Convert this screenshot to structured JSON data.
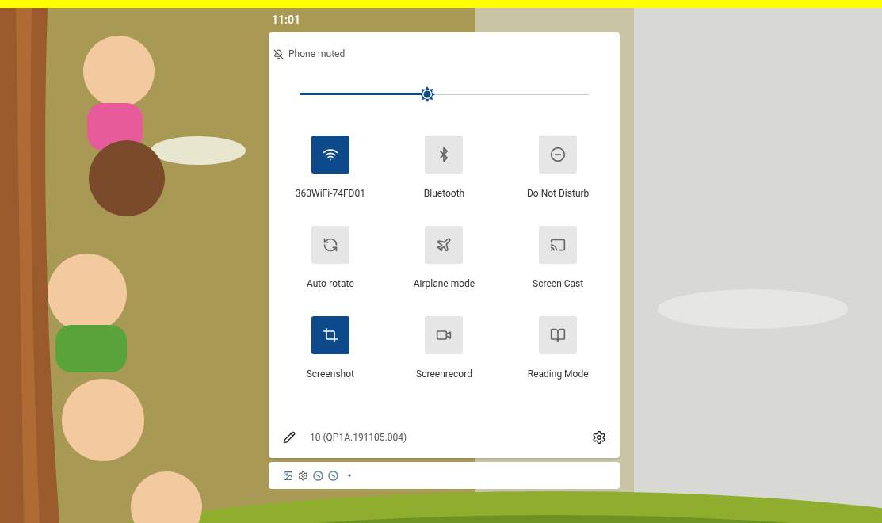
{
  "status_bar": {
    "time": "11:01"
  },
  "quick_settings": {
    "ringer_status": "Phone muted",
    "brightness": {
      "level": 0.44
    },
    "tiles": [
      {
        "label": "360WiFi-74FD01",
        "on": true
      },
      {
        "label": "Bluetooth",
        "on": false
      },
      {
        "label": "Do Not Disturb",
        "on": false
      },
      {
        "label": "Auto-rotate",
        "on": false
      },
      {
        "label": "Airplane mode",
        "on": false
      },
      {
        "label": "Screen Cast",
        "on": false
      },
      {
        "label": "Screenshot",
        "on": true
      },
      {
        "label": "Screenrecord",
        "on": false
      },
      {
        "label": "Reading Mode",
        "on": false
      }
    ],
    "build": "10 (QP1A.191105.004)"
  }
}
